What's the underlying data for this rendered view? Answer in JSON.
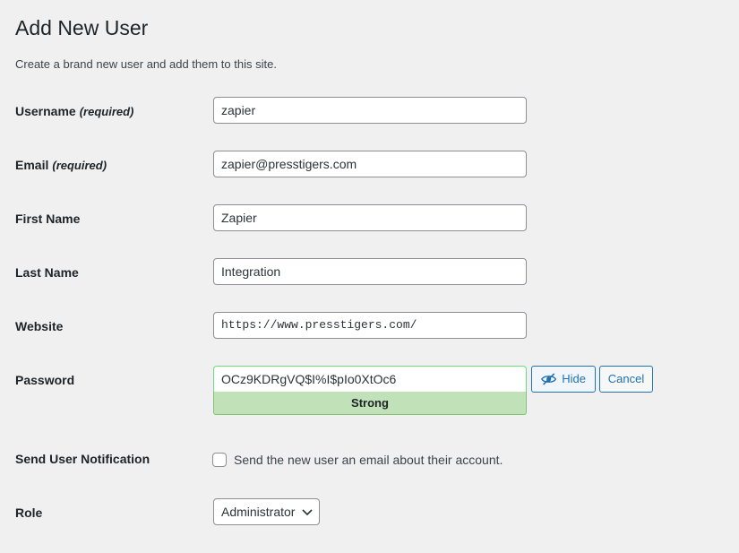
{
  "header": {
    "title": "Add New User",
    "subtitle": "Create a brand new user and add them to this site."
  },
  "form": {
    "username": {
      "label": "Username",
      "required": "(required)",
      "value": "zapier"
    },
    "email": {
      "label": "Email",
      "required": "(required)",
      "value": "zapier@presstigers.com"
    },
    "first_name": {
      "label": "First Name",
      "value": "Zapier"
    },
    "last_name": {
      "label": "Last Name",
      "value": "Integration"
    },
    "website": {
      "label": "Website",
      "value": "https://www.presstigers.com/"
    },
    "password": {
      "label": "Password",
      "value": "OCz9KDRgVQ$I%I$pIo0XtOc6",
      "strength": "Strong",
      "hide_label": "Hide",
      "cancel_label": "Cancel"
    },
    "notification": {
      "label": "Send User Notification",
      "checkbox_label": "Send the new user an email about their account.",
      "checked": false
    },
    "role": {
      "label": "Role",
      "value": "Administrator"
    }
  },
  "colors": {
    "accent": "#2271b1",
    "background": "#f0f0f1",
    "strength_strong": "#c1e1b9"
  },
  "icons": {
    "hide_button": "eye-slash-icon",
    "role_select": "chevron-down-icon"
  }
}
